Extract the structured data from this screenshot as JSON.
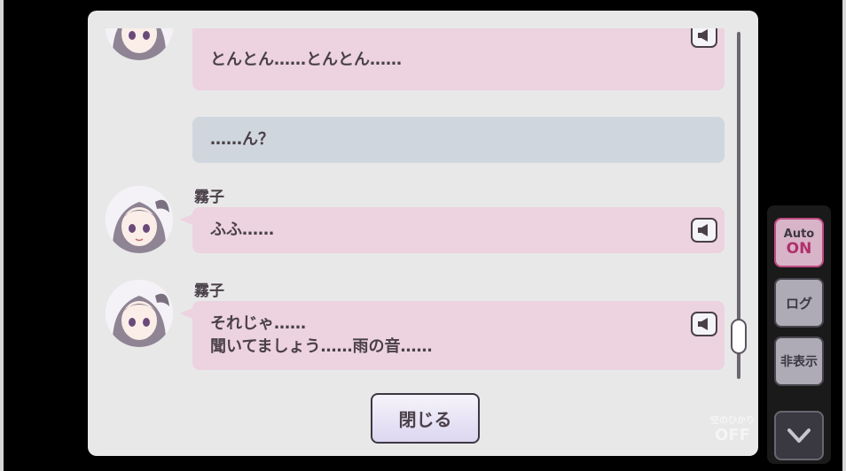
{
  "log": {
    "entries": [
      {
        "speaker": "",
        "lines": [
          "とんとん……とんとん……"
        ],
        "type": "dialogue",
        "has_voice": true
      },
      {
        "speaker": "",
        "lines": [
          "……ん？"
        ],
        "type": "narration",
        "has_voice": false
      },
      {
        "speaker": "霧子",
        "lines": [
          "ふふ……"
        ],
        "type": "dialogue",
        "has_voice": true
      },
      {
        "speaker": "霧子",
        "lines": [
          "それじゃ……",
          "聞いてましょう……雨の音……"
        ],
        "type": "dialogue",
        "has_voice": true
      }
    ],
    "close_label": "閉じる"
  },
  "side": {
    "auto_label_top": "Auto",
    "auto_label_bottom": "ON",
    "log_label": "ログ",
    "hide_label": "非表示"
  },
  "watermark": {
    "small": "空のひかり",
    "big": "OFF"
  },
  "colors": {
    "panel_bg": "#e8e8e8",
    "bubble_dialogue": "#ecd3df",
    "bubble_narration": "#cfd6de",
    "text": "#4a4048",
    "auto_on": "#b0306a"
  },
  "icons": [
    "speaker-icon",
    "chevron-down-icon",
    "character-avatar"
  ]
}
